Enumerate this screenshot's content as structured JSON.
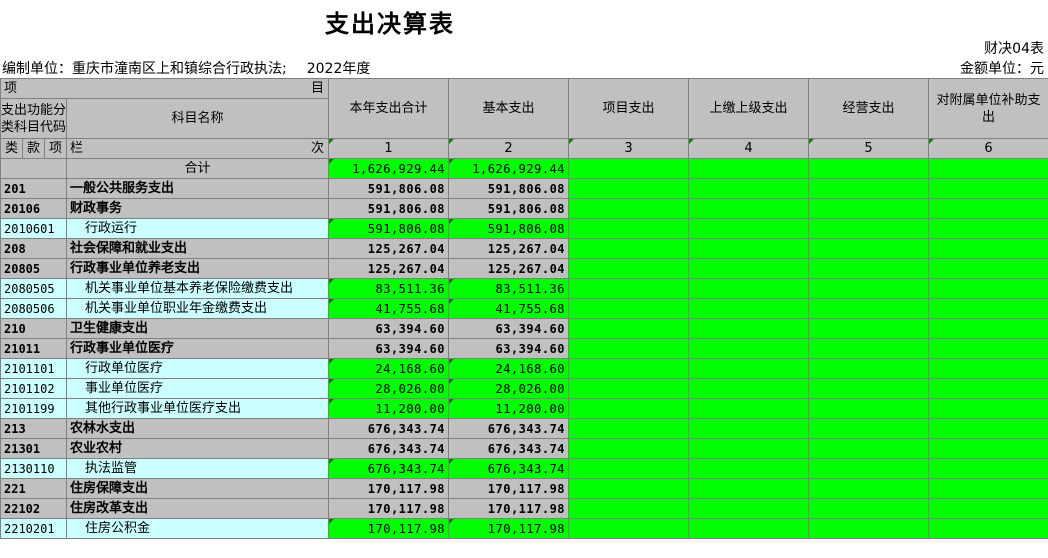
{
  "title": "支出决算表",
  "form_no": "财决04表",
  "unit_label": "编制单位：重庆市潼南区上和镇综合行政执法;",
  "year": "2022年度",
  "amount_unit": "金额单位：元",
  "header": {
    "xiang": "项",
    "mu": "目",
    "code_title": "支出功能分类科目代码",
    "name_title": "科目名称",
    "lan": "栏",
    "ci": "次",
    "lei": "类",
    "kuan": "款",
    "xiang2": "项",
    "columns": [
      {
        "label": "本年支出合计",
        "no": "1"
      },
      {
        "label": "基本支出",
        "no": "2"
      },
      {
        "label": "项目支出",
        "no": "3"
      },
      {
        "label": "上缴上级支出",
        "no": "4"
      },
      {
        "label": "经营支出",
        "no": "5"
      },
      {
        "label": "对附属单位补助支出",
        "no": "6"
      }
    ]
  },
  "total": {
    "label": "合计",
    "c1": "1,626,929.44",
    "c2": "1,626,929.44"
  },
  "rows": [
    {
      "code": "201",
      "name": "一般公共服务支出",
      "c1": "591,806.08",
      "c2": "591,806.08",
      "level": "top"
    },
    {
      "code": "20106",
      "name": "财政事务",
      "c1": "591,806.08",
      "c2": "591,806.08",
      "level": "mid"
    },
    {
      "code": "2010601",
      "name": "行政运行",
      "c1": "591,806.08",
      "c2": "591,806.08",
      "level": "leaf"
    },
    {
      "code": "208",
      "name": "社会保障和就业支出",
      "c1": "125,267.04",
      "c2": "125,267.04",
      "level": "top"
    },
    {
      "code": "20805",
      "name": "行政事业单位养老支出",
      "c1": "125,267.04",
      "c2": "125,267.04",
      "level": "mid"
    },
    {
      "code": "2080505",
      "name": "机关事业单位基本养老保险缴费支出",
      "c1": "83,511.36",
      "c2": "83,511.36",
      "level": "leaf"
    },
    {
      "code": "2080506",
      "name": "机关事业单位职业年金缴费支出",
      "c1": "41,755.68",
      "c2": "41,755.68",
      "level": "leaf"
    },
    {
      "code": "210",
      "name": "卫生健康支出",
      "c1": "63,394.60",
      "c2": "63,394.60",
      "level": "top"
    },
    {
      "code": "21011",
      "name": "行政事业单位医疗",
      "c1": "63,394.60",
      "c2": "63,394.60",
      "level": "mid"
    },
    {
      "code": "2101101",
      "name": "行政单位医疗",
      "c1": "24,168.60",
      "c2": "24,168.60",
      "level": "leaf"
    },
    {
      "code": "2101102",
      "name": "事业单位医疗",
      "c1": "28,026.00",
      "c2": "28,026.00",
      "level": "leaf"
    },
    {
      "code": "2101199",
      "name": "其他行政事业单位医疗支出",
      "c1": "11,200.00",
      "c2": "11,200.00",
      "level": "leaf"
    },
    {
      "code": "213",
      "name": "农林水支出",
      "c1": "676,343.74",
      "c2": "676,343.74",
      "level": "top"
    },
    {
      "code": "21301",
      "name": "农业农村",
      "c1": "676,343.74",
      "c2": "676,343.74",
      "level": "mid"
    },
    {
      "code": "2130110",
      "name": "执法监管",
      "c1": "676,343.74",
      "c2": "676,343.74",
      "level": "leaf"
    },
    {
      "code": "221",
      "name": "住房保障支出",
      "c1": "170,117.98",
      "c2": "170,117.98",
      "level": "top"
    },
    {
      "code": "22102",
      "name": "住房改革支出",
      "c1": "170,117.98",
      "c2": "170,117.98",
      "level": "mid"
    },
    {
      "code": "2210201",
      "name": "住房公积金",
      "c1": "170,117.98",
      "c2": "170,117.98",
      "level": "leaf"
    }
  ],
  "colors": {
    "header_gray": "#c0c0c0",
    "value_green": "#00ff00",
    "leaf_cyan": "#ccffff"
  }
}
